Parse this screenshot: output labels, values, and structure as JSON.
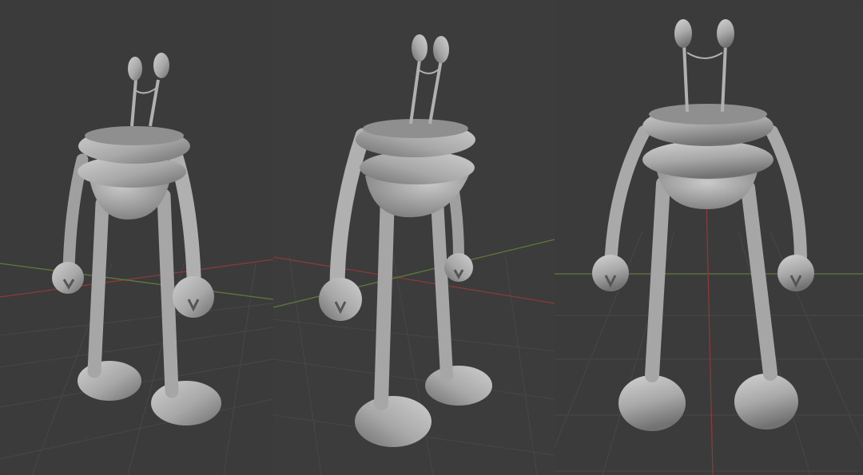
{
  "image": {
    "kind": "3d-character-turnaround",
    "views": [
      {
        "name": "three-quarter-left"
      },
      {
        "name": "three-quarter-right"
      },
      {
        "name": "front"
      }
    ],
    "colors": {
      "viewport_background": "#3b3b3b",
      "grid_line": "#4a4a4a",
      "x_axis": "#8a3a3a",
      "y_axis": "#5f7a3a",
      "model": "#a9a9a9",
      "model_shadow": "#7c7c7c",
      "model_highlight": "#d0d0d0"
    }
  }
}
